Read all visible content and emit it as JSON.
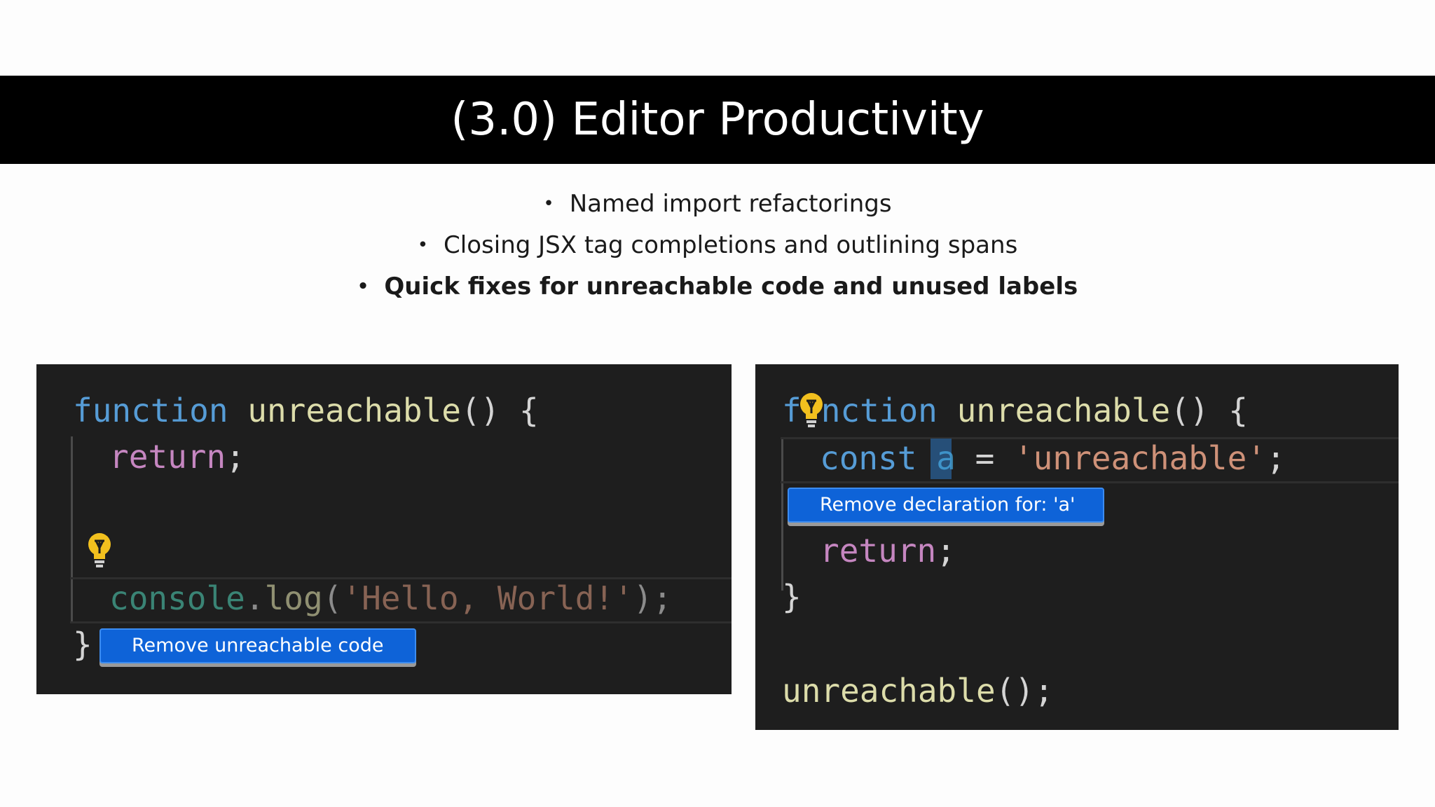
{
  "slide": {
    "title": "(3.0) Editor Productivity",
    "bullets": [
      "Named import refactorings",
      "Closing JSX tag completions and outlining spans",
      "Quick fixes for unreachable code and unused labels"
    ],
    "bullet_symbol": "•"
  },
  "left_editor": {
    "line1": {
      "kw": "function",
      "fn": "unreachable",
      "rest": "() {"
    },
    "line2": {
      "ctl": "return",
      "rest": ";"
    },
    "line3": {
      "obj": "console",
      "dot": ".",
      "fn": "log",
      "open": "(",
      "str": "'Hello, World!'",
      "close": ");"
    },
    "line4": {
      "brace": "}"
    },
    "quickfix_label": "Remove unreachable code",
    "lightbulb_icon": "lightbulb-icon"
  },
  "right_editor": {
    "line1": {
      "kw_a": "f",
      "kw_b": "nction",
      "fn": "unreachable",
      "rest": "() {"
    },
    "line2": {
      "kw": "const",
      "var": "a",
      "eq": " = ",
      "str": "'unreachable'",
      "semi": ";"
    },
    "line3": {
      "ctl": "return",
      "rest": ";"
    },
    "line4": {
      "brace": "}"
    },
    "line5": {
      "fn": "unreachable",
      "rest": "();"
    },
    "quickfix_label": "Remove declaration for: 'a'",
    "lightbulb_icon": "lightbulb-icon"
  },
  "colors": {
    "editor_bg": "#1e1e1e",
    "keyword": "#569cd6",
    "function": "#dcdcaa",
    "control": "#c586c0",
    "string": "#ce9178",
    "class": "#4ec9b0",
    "quickfix_bg": "#0e63d8",
    "bulb": "#f2c01e"
  }
}
